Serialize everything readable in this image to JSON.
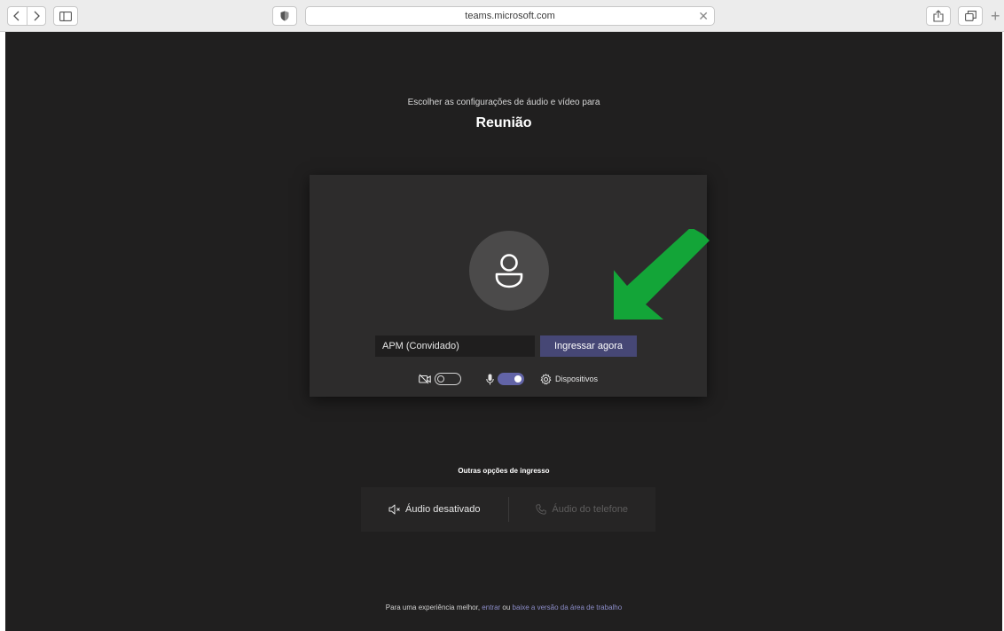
{
  "browser": {
    "url": "teams.microsoft.com",
    "back_icon": "chevron-left-icon",
    "forward_icon": "chevron-right-icon",
    "sidebar_icon": "sidebar-icon",
    "shield_icon": "shield-icon",
    "share_icon": "share-icon",
    "tabs_icon": "tabs-icon",
    "plus_label": "+"
  },
  "prejoin": {
    "subtitle": "Escolher as configurações de áudio e vídeo para",
    "meeting_title": "Reunião",
    "name_value": "APM (Convidado)",
    "join_label": "Ingressar agora",
    "camera_enabled": false,
    "mic_enabled": true,
    "devices_label": "Dispositivos"
  },
  "other_options": {
    "title": "Outras opções de ingresso",
    "audio_off_label": "Áudio desativado",
    "phone_label": "Áudio do telefone"
  },
  "footer": {
    "prefix": "Para uma experiência melhor, ",
    "signin_link": "entrar",
    "middle": " ou ",
    "download_link": "baixe a versão da área de trabalho"
  },
  "colors": {
    "page_bg": "#201f1f",
    "card_bg": "#2d2c2c",
    "accent": "#6264a7",
    "join_button": "#464775",
    "annotation_arrow": "#13a538"
  }
}
